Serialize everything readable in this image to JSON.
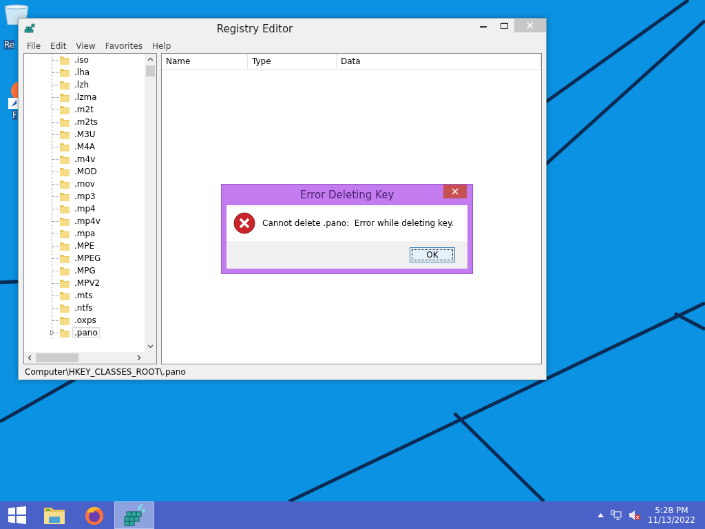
{
  "desktop_icons": [
    {
      "kind": "recycle-bin",
      "label": "Re"
    },
    {
      "kind": "firefox",
      "label": "F"
    }
  ],
  "window": {
    "title": "Registry Editor",
    "menu": [
      "File",
      "Edit",
      "View",
      "Favorites",
      "Help"
    ],
    "tree": [
      {
        "label": ".iso",
        "selected": false,
        "expandable": false
      },
      {
        "label": ".lha",
        "selected": false,
        "expandable": false
      },
      {
        "label": ".lzh",
        "selected": false,
        "expandable": false
      },
      {
        "label": ".lzma",
        "selected": false,
        "expandable": false
      },
      {
        "label": ".m2t",
        "selected": false,
        "expandable": false
      },
      {
        "label": ".m2ts",
        "selected": false,
        "expandable": false
      },
      {
        "label": ".M3U",
        "selected": false,
        "expandable": false
      },
      {
        "label": ".M4A",
        "selected": false,
        "expandable": false
      },
      {
        "label": ".m4v",
        "selected": false,
        "expandable": false
      },
      {
        "label": ".MOD",
        "selected": false,
        "expandable": false
      },
      {
        "label": ".mov",
        "selected": false,
        "expandable": false
      },
      {
        "label": ".mp3",
        "selected": false,
        "expandable": false
      },
      {
        "label": ".mp4",
        "selected": false,
        "expandable": false
      },
      {
        "label": ".mp4v",
        "selected": false,
        "expandable": false
      },
      {
        "label": ".mpa",
        "selected": false,
        "expandable": false
      },
      {
        "label": ".MPE",
        "selected": false,
        "expandable": false
      },
      {
        "label": ".MPEG",
        "selected": false,
        "expandable": false
      },
      {
        "label": ".MPG",
        "selected": false,
        "expandable": false
      },
      {
        "label": ".MPV2",
        "selected": false,
        "expandable": false
      },
      {
        "label": ".mts",
        "selected": false,
        "expandable": false
      },
      {
        "label": ".ntfs",
        "selected": false,
        "expandable": false
      },
      {
        "label": ".oxps",
        "selected": false,
        "expandable": false
      },
      {
        "label": ".pano",
        "selected": true,
        "expandable": true
      }
    ],
    "columns": [
      "Name",
      "Type",
      "Data"
    ],
    "status_bar": "Computer\\HKEY_CLASSES_ROOT\\.pano"
  },
  "dialog": {
    "title": "Error Deleting Key",
    "message": "Cannot delete .pano:  Error while deleting key.",
    "buttons": [
      "OK"
    ]
  },
  "taskbar": {
    "apps": [
      {
        "kind": "explorer",
        "selected": false
      },
      {
        "kind": "firefox",
        "selected": false
      },
      {
        "kind": "regedit",
        "selected": true
      }
    ],
    "time": "5:28 PM",
    "date": "11/13/2022"
  }
}
